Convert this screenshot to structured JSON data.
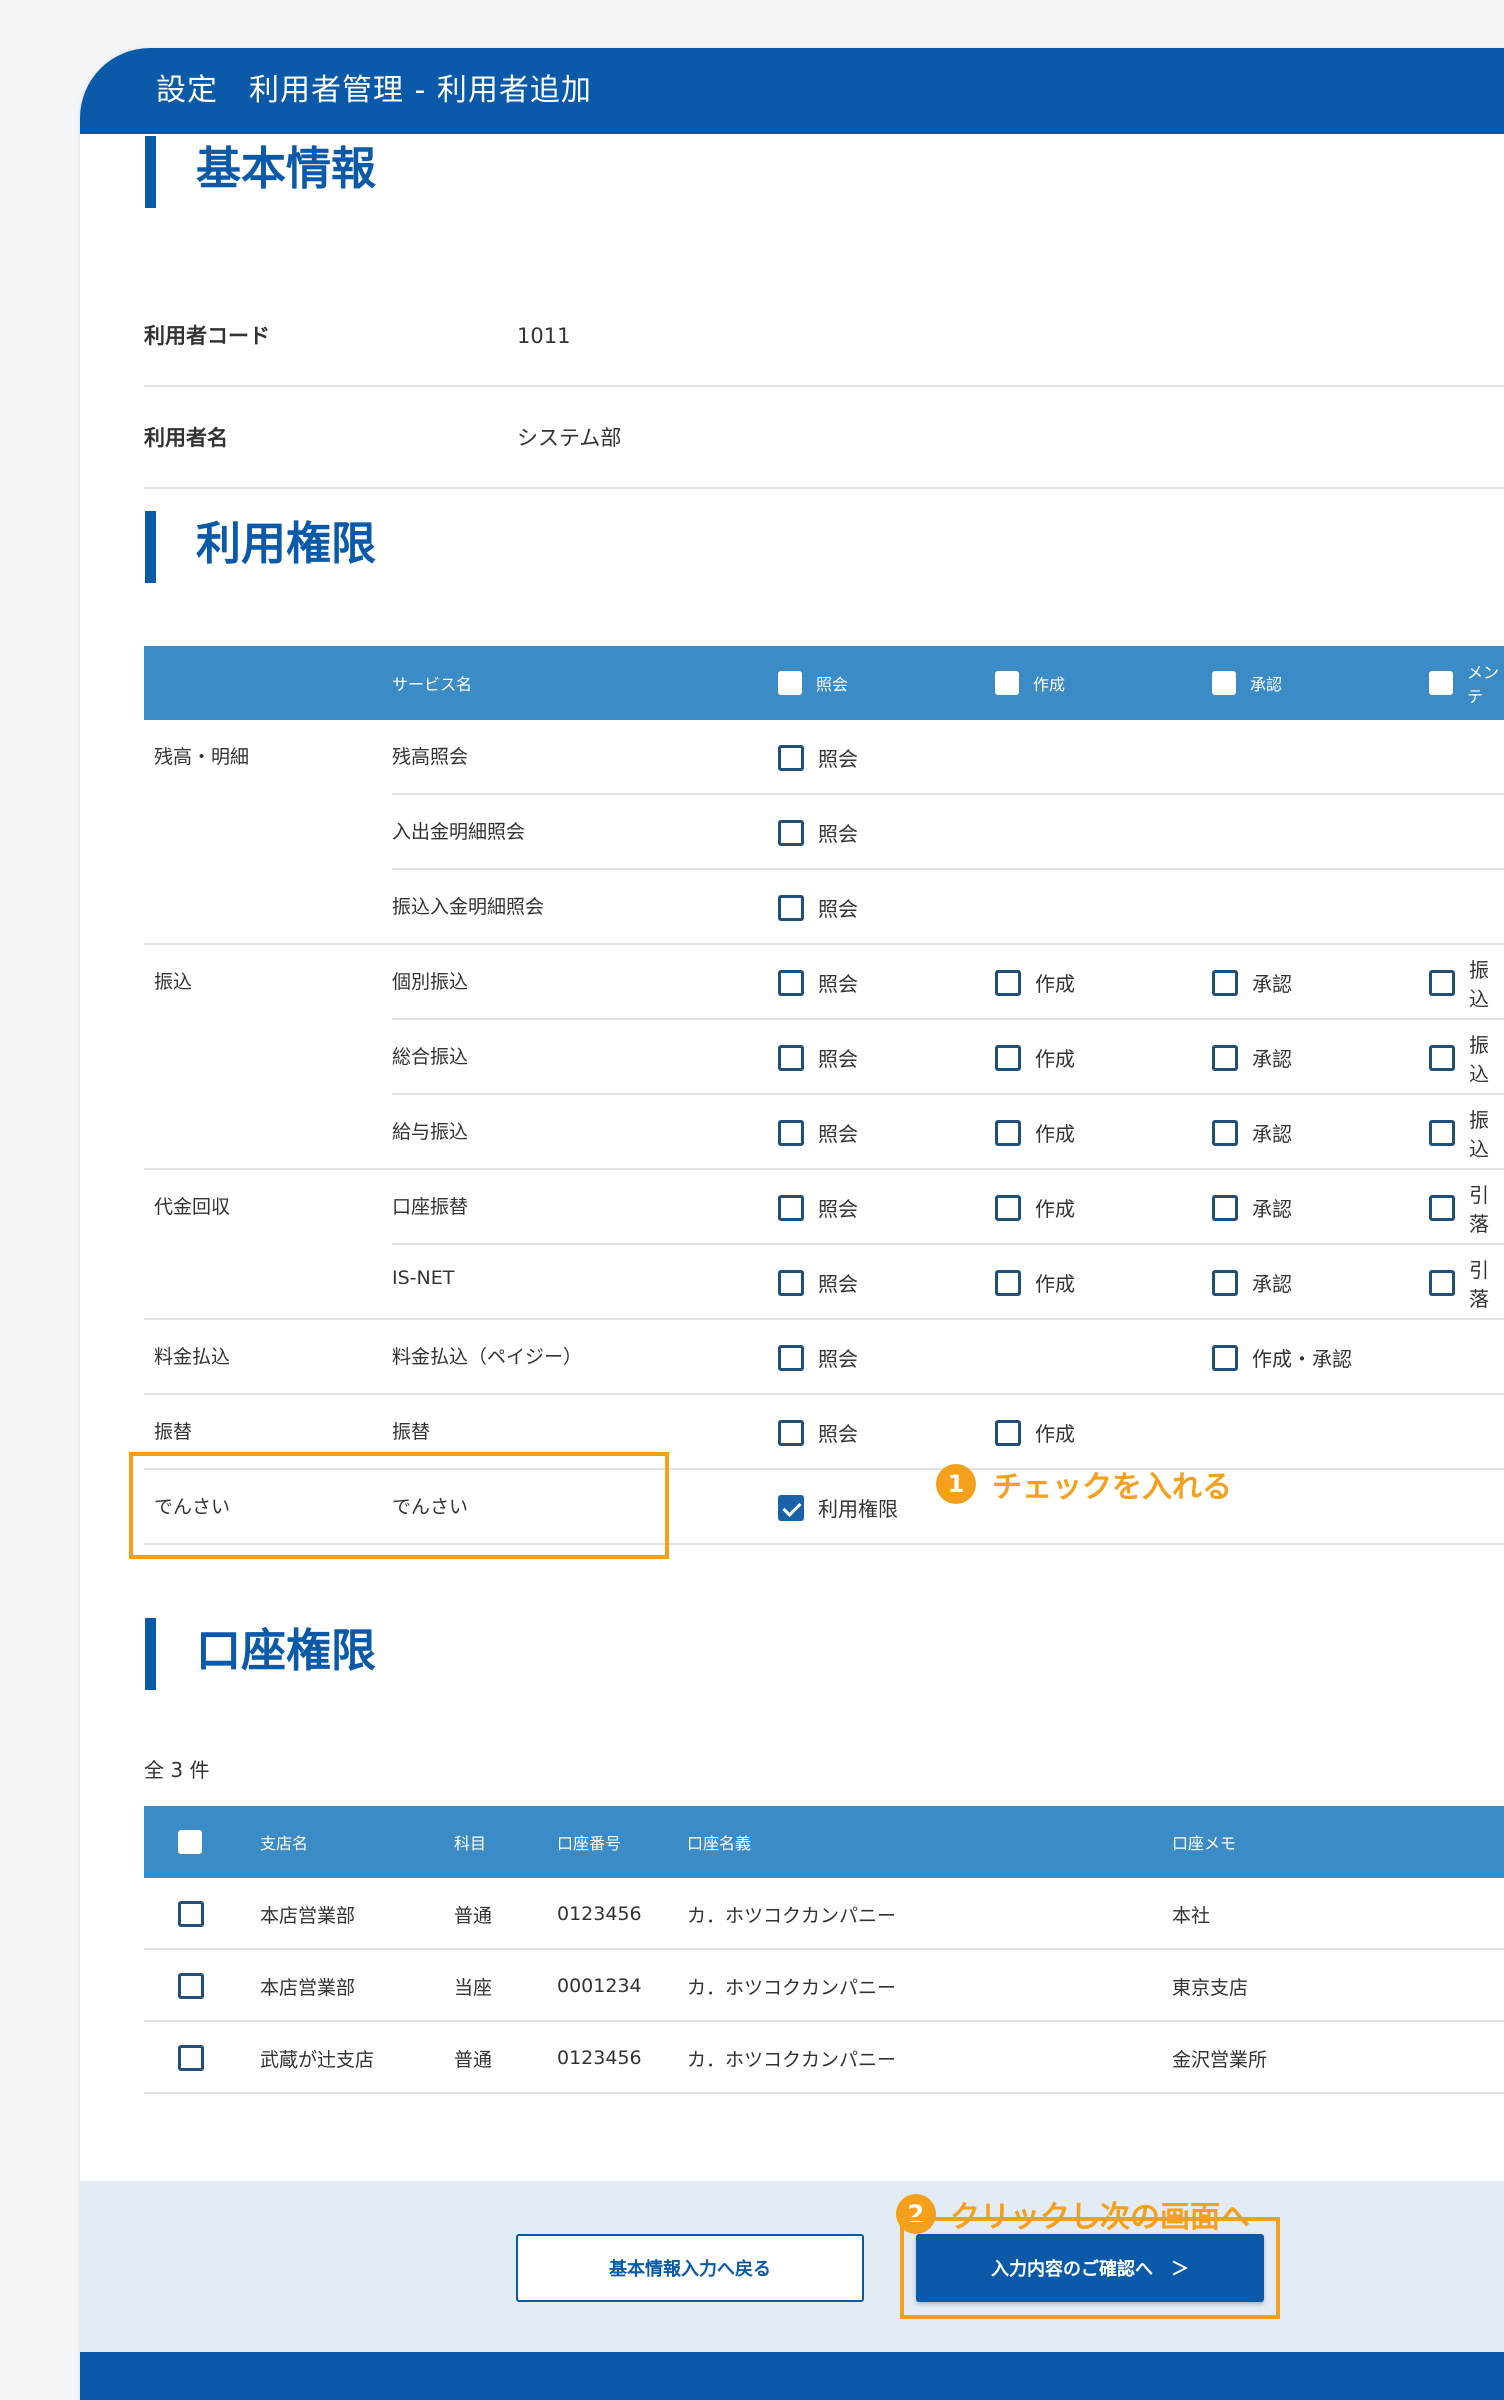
{
  "header": {
    "title": "設定　利用者管理 - 利用者追加"
  },
  "basic": {
    "title": "基本情報",
    "rows": [
      {
        "label": "利用者コード",
        "value": "1011"
      },
      {
        "label": "利用者名",
        "value": "システム部"
      }
    ]
  },
  "perm": {
    "title": "利用権限",
    "head": {
      "service": "サービス名",
      "inquiry": "照会",
      "create": "作成",
      "approve": "承認",
      "maint": "メンテ"
    },
    "rows": [
      {
        "cat": "残高・明細",
        "svc": "残高照会",
        "a": "照会"
      },
      {
        "cat": "",
        "svc": "入出金明細照会",
        "a": "照会"
      },
      {
        "cat": "",
        "svc": "振込入金明細照会",
        "a": "照会"
      },
      {
        "cat": "振込",
        "svc": "個別振込",
        "a": "照会",
        "b": "作成",
        "c": "承認",
        "d": "振込"
      },
      {
        "cat": "",
        "svc": "総合振込",
        "a": "照会",
        "b": "作成",
        "c": "承認",
        "d": "振込"
      },
      {
        "cat": "",
        "svc": "給与振込",
        "a": "照会",
        "b": "作成",
        "c": "承認",
        "d": "振込"
      },
      {
        "cat": "代金回収",
        "svc": "口座振替",
        "a": "照会",
        "b": "作成",
        "c": "承認",
        "d": "引落"
      },
      {
        "cat": "",
        "svc": "IS-NET",
        "a": "照会",
        "b": "作成",
        "c": "承認",
        "d": "引落"
      },
      {
        "cat": "料金払込",
        "svc": "料金払込（ペイジー）",
        "a": "照会",
        "c": "作成・承認"
      },
      {
        "cat": "振替",
        "svc": "振替",
        "a": "照会",
        "b": "作成"
      },
      {
        "cat": "でんさい",
        "svc": "でんさい",
        "a": "利用権限"
      }
    ]
  },
  "annot1": {
    "num": "1",
    "text": "チェックを入れる"
  },
  "acct": {
    "title": "口座権限",
    "count": "全 3 件",
    "head": {
      "branch": "支店名",
      "type": "科目",
      "number": "口座番号",
      "name": "口座名義",
      "memo": "口座メモ"
    },
    "rows": [
      {
        "branch": "本店営業部",
        "type": "普通",
        "number": "0123456",
        "name": "カ．ホツコクカンパニー",
        "memo": "本社"
      },
      {
        "branch": "本店営業部",
        "type": "当座",
        "number": "0001234",
        "name": "カ．ホツコクカンパニー",
        "memo": "東京支店"
      },
      {
        "branch": "武蔵が辻支店",
        "type": "普通",
        "number": "0123456",
        "name": "カ．ホツコクカンパニー",
        "memo": "金沢営業所"
      }
    ]
  },
  "annot2": {
    "num": "2",
    "text": "クリックし次の画面へ"
  },
  "buttons": {
    "back": "基本情報入力へ戻る",
    "next": "入力内容のご確認へ　＞"
  },
  "colors": {
    "brand": "#0b5aa9",
    "table_head": "#3b8bc6",
    "annotation": "#f5a01c"
  }
}
